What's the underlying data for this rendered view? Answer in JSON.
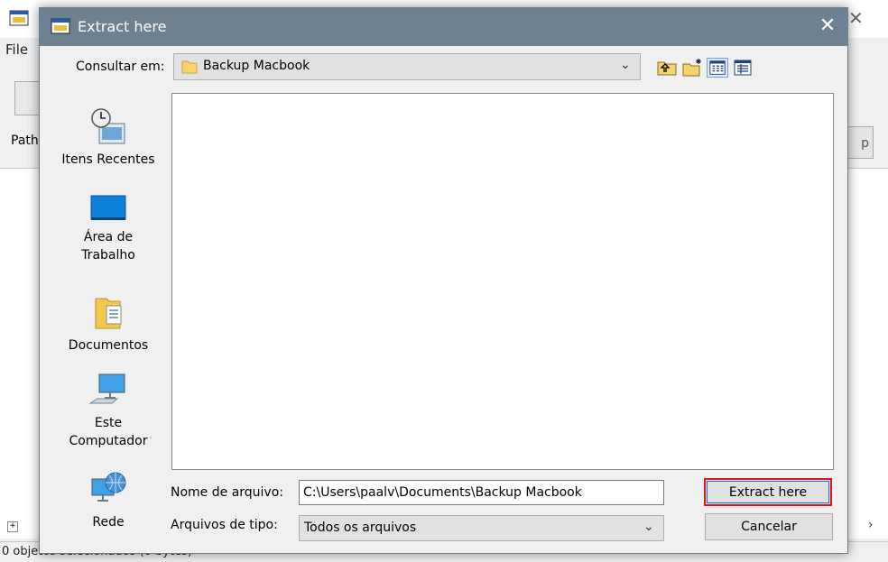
{
  "background": {
    "menu_file": "File",
    "path_label": "Path",
    "right_button": "p",
    "status_text": "0 objetos selecionados (0 bytes)"
  },
  "dialog": {
    "title": "Extract here",
    "look_in": {
      "label": "Consultar em:",
      "value": "Backup Macbook"
    },
    "toolbar_icons": [
      "up-folder-icon",
      "new-folder-icon",
      "list-view-icon",
      "details-view-icon"
    ],
    "places": [
      {
        "id": "recent",
        "label": "Itens Recentes",
        "icon": "recent-items-icon"
      },
      {
        "id": "desktop",
        "label": "Área de Trabalho",
        "icon": "desktop-icon"
      },
      {
        "id": "documents",
        "label": "Documentos",
        "icon": "documents-icon"
      },
      {
        "id": "computer",
        "label": "Este Computador",
        "icon": "computer-icon"
      },
      {
        "id": "network",
        "label": "Rede",
        "icon": "network-icon"
      }
    ],
    "file_name": {
      "label": "Nome de arquivo:",
      "value": "C:\\Users\\paalv\\Documents\\Backup Macbook"
    },
    "file_type": {
      "label": "Arquivos de tipo:",
      "value": "Todos os arquivos"
    },
    "buttons": {
      "extract": "Extract here",
      "cancel": "Cancelar"
    }
  },
  "colors": {
    "title_bar": "#6d8190",
    "highlight_border": "#e0151c"
  }
}
